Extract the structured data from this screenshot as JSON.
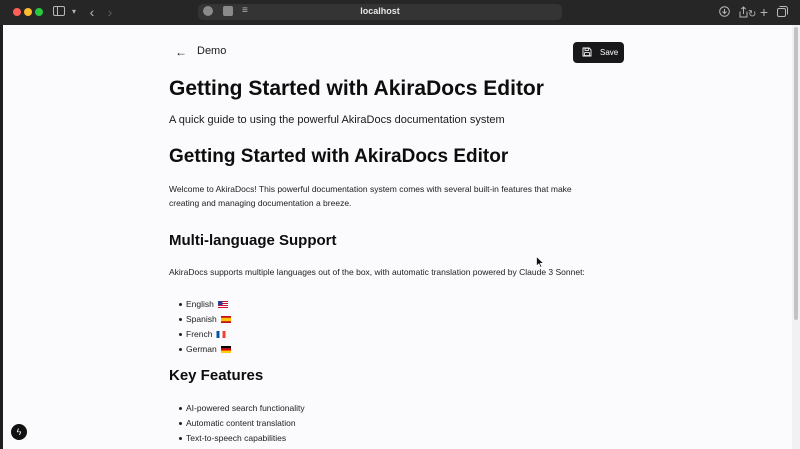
{
  "browser": {
    "url": "localhost",
    "icons": {
      "sidebar": "sidebar-toggle-icon",
      "back": "back-arrow-icon",
      "forward": "forward-arrow-icon",
      "reload": "reload-icon",
      "download": "download-icon",
      "share": "share-icon",
      "new_tab": "plus-icon",
      "tabs": "tab-overview-icon"
    }
  },
  "page": {
    "breadcrumb_label": "Demo",
    "save_label": "Save",
    "title": "Getting Started with AkiraDocs Editor",
    "subtitle": "A quick guide to using the powerful AkiraDocs documentation system",
    "heading": "Getting Started with AkiraDocs Editor",
    "intro": "Welcome to AkiraDocs! This powerful documentation system comes with several built-in features that make creating and managing documentation a breeze.",
    "multilang": {
      "heading": "Multi-language Support",
      "paragraph": "AkiraDocs supports multiple languages out of the box, with automatic translation powered by Claude 3 Sonnet:",
      "languages": [
        {
          "label": "English",
          "flag": "us-flag-icon"
        },
        {
          "label": "Spanish",
          "flag": "spain-flag-icon"
        },
        {
          "label": "French",
          "flag": "france-flag-icon"
        },
        {
          "label": "German",
          "flag": "germany-flag-icon"
        }
      ]
    },
    "features": {
      "heading": "Key Features",
      "items": [
        "AI-powered search functionality",
        "Automatic content translation",
        "Text-to-speech capabilities"
      ]
    }
  },
  "colors": {
    "save_button_bg": "#18181b",
    "page_bg": "#fbfafc",
    "chrome_bg": "#262626"
  }
}
